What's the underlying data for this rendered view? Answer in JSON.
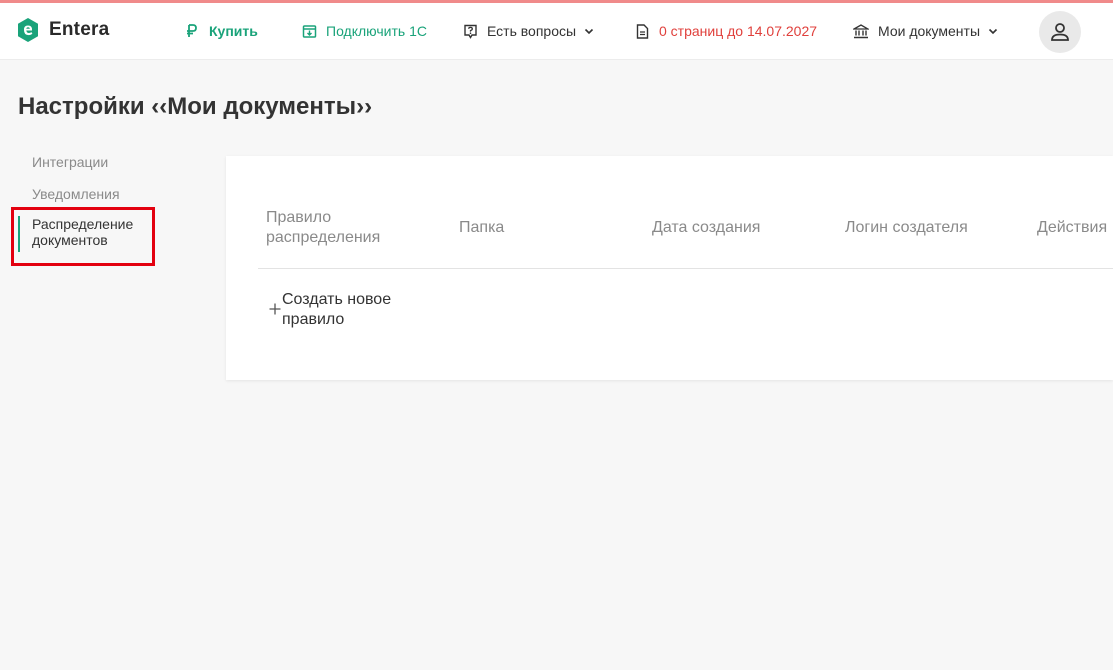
{
  "app": {
    "logo_text": "Entera"
  },
  "header": {
    "buy_label": "Купить",
    "connect_label": "Подключить 1С",
    "questions_label": "Есть вопросы",
    "pages_label": "0 страниц до 14.07.2027",
    "mydocs_label": "Мои документы"
  },
  "page": {
    "title": "Настройки ‹‹Мои документы››"
  },
  "sidebar": {
    "items": [
      {
        "label": "Интеграции"
      },
      {
        "label": "Уведомления"
      },
      {
        "label": "Распределение документов"
      }
    ]
  },
  "table": {
    "columns": [
      "Правило распределения",
      "Папка",
      "Дата создания",
      "Логин создателя",
      "Действия"
    ],
    "create_label": "Создать новое правило"
  },
  "colors": {
    "accent": "#1aa37a",
    "warning": "#e0403c",
    "highlight": "#e3000f"
  }
}
